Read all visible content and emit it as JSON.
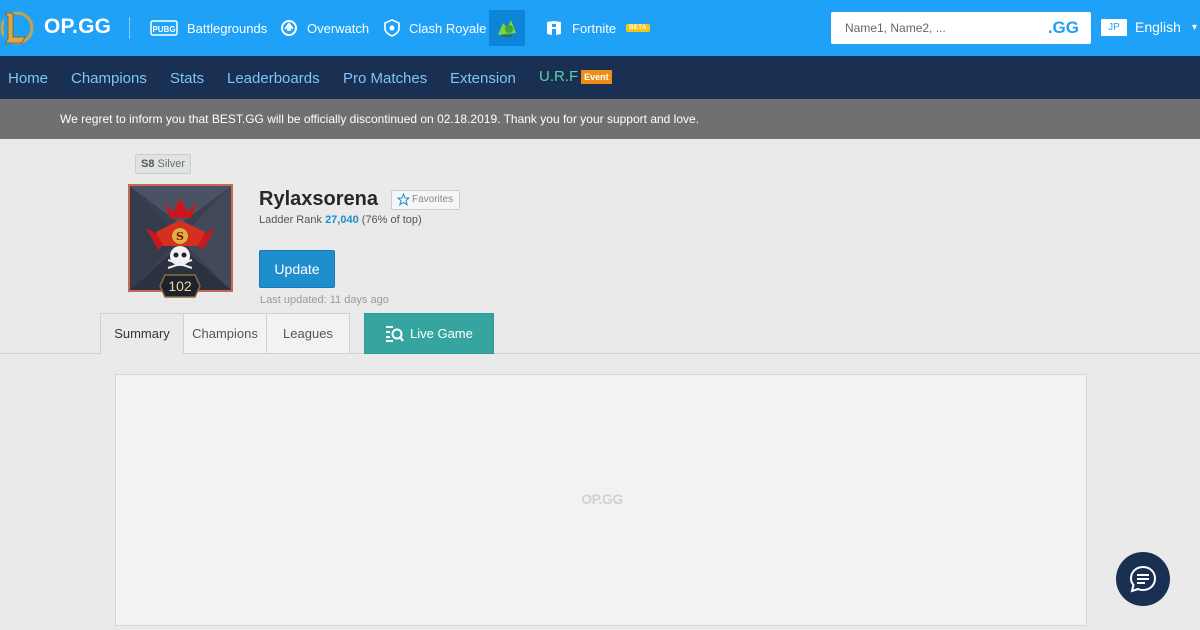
{
  "topbar": {
    "brand": "OP.GG",
    "games": [
      {
        "label": "Battlegrounds",
        "icon": "pubg-icon"
      },
      {
        "label": "Overwatch",
        "icon": "overwatch-icon"
      },
      {
        "label": "Clash Royale",
        "icon": "clash-royale-icon"
      },
      {
        "label": "",
        "icon": "lol-champion-icon"
      },
      {
        "label": "Fortnite",
        "icon": "fortnite-icon",
        "badge": "BETA"
      }
    ],
    "search": {
      "placeholder": "Name1, Name2, ...",
      "suffix": ".GG"
    },
    "region": "JP",
    "language": "English"
  },
  "nav": {
    "items": [
      "Home",
      "Champions",
      "Stats",
      "Leaderboards",
      "Pro Matches",
      "Extension",
      "U.R.F"
    ],
    "event_badge": "Event"
  },
  "notice": "We regret to inform you that BEST.GG will be officially discontinued on 02.18.2019. Thank you for your support and love.",
  "profile": {
    "season": "S8",
    "tier": "Silver",
    "level": "102",
    "name": "Rylaxsorena",
    "favorites_label": "Favorites",
    "ladder_label": "Ladder Rank",
    "ladder_rank": "27,040",
    "ladder_pct": "(76% of top)",
    "update_label": "Update",
    "last_updated": "Last updated: 11 days ago"
  },
  "tabs": [
    "Summary",
    "Champions",
    "Leagues"
  ],
  "live_game_label": "Live Game",
  "content": {
    "loading_logo": "OP.GG"
  },
  "colors": {
    "topbar": "#1ea1f7",
    "nav": "#1a3053",
    "urf": "#52d3ab",
    "event": "#ec8e16",
    "update": "#1f8ecd",
    "live": "#37a59f"
  }
}
